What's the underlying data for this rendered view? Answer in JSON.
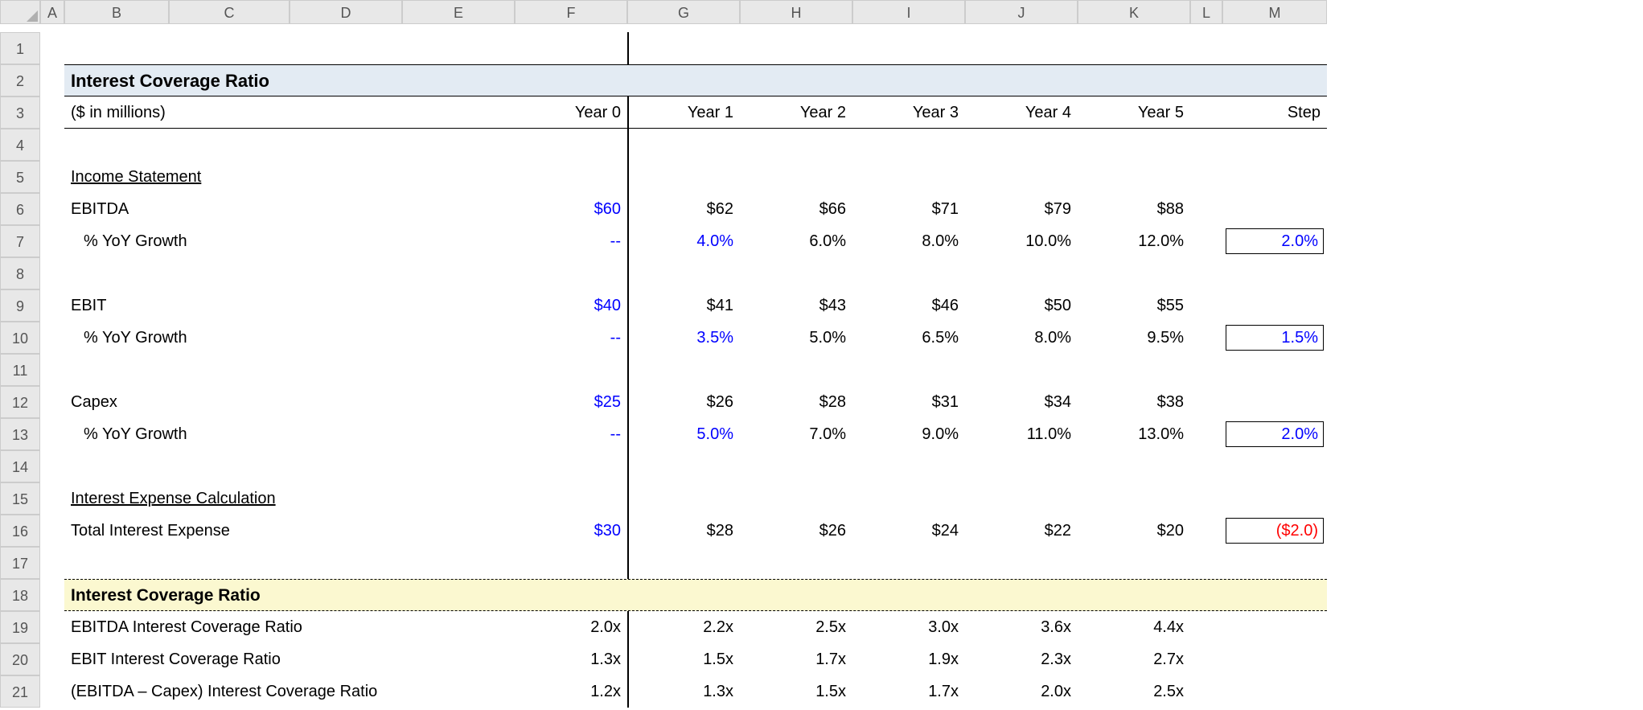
{
  "columns": [
    "A",
    "B",
    "C",
    "D",
    "E",
    "F",
    "G",
    "H",
    "I",
    "J",
    "K",
    "L",
    "M"
  ],
  "rowCount": 21,
  "title": "Interest Coverage Ratio",
  "units": "($ in millions)",
  "yearHeaders": [
    "Year 0",
    "Year 1",
    "Year 2",
    "Year 3",
    "Year 4",
    "Year 5"
  ],
  "stepLabel": "Step",
  "sections": {
    "income": "Income Statement",
    "interestCalc": "Interest Expense Calculation",
    "ratio": "Interest Coverage Ratio"
  },
  "rows": {
    "ebitda": {
      "label": "EBITDA",
      "y0": "$60",
      "y1": "$62",
      "y2": "$66",
      "y3": "$71",
      "y4": "$79",
      "y5": "$88"
    },
    "ebitdaYoY": {
      "label": "% YoY Growth",
      "y0": "--",
      "y1": "4.0%",
      "y2": "6.0%",
      "y3": "8.0%",
      "y4": "10.0%",
      "y5": "12.0%",
      "step": "2.0%"
    },
    "ebit": {
      "label": "EBIT",
      "y0": "$40",
      "y1": "$41",
      "y2": "$43",
      "y3": "$46",
      "y4": "$50",
      "y5": "$55"
    },
    "ebitYoY": {
      "label": "% YoY Growth",
      "y0": "--",
      "y1": "3.5%",
      "y2": "5.0%",
      "y3": "6.5%",
      "y4": "8.0%",
      "y5": "9.5%",
      "step": "1.5%"
    },
    "capex": {
      "label": "Capex",
      "y0": "$25",
      "y1": "$26",
      "y2": "$28",
      "y3": "$31",
      "y4": "$34",
      "y5": "$38"
    },
    "capexYoY": {
      "label": "% YoY Growth",
      "y0": "--",
      "y1": "5.0%",
      "y2": "7.0%",
      "y3": "9.0%",
      "y4": "11.0%",
      "y5": "13.0%",
      "step": "2.0%"
    },
    "intExp": {
      "label": "Total Interest Expense",
      "y0": "$30",
      "y1": "$28",
      "y2": "$26",
      "y3": "$24",
      "y4": "$22",
      "y5": "$20",
      "step": "($2.0)"
    },
    "ratioEbitda": {
      "label": "EBITDA Interest Coverage Ratio",
      "y0": "2.0x",
      "y1": "2.2x",
      "y2": "2.5x",
      "y3": "3.0x",
      "y4": "3.6x",
      "y5": "4.4x"
    },
    "ratioEbit": {
      "label": "EBIT Interest Coverage Ratio",
      "y0": "1.3x",
      "y1": "1.5x",
      "y2": "1.7x",
      "y3": "1.9x",
      "y4": "2.3x",
      "y5": "2.7x"
    },
    "ratioEbCapex": {
      "label": "(EBITDA – Capex) Interest Coverage Ratio",
      "y0": "1.2x",
      "y1": "1.3x",
      "y2": "1.5x",
      "y3": "1.7x",
      "y4": "2.0x",
      "y5": "2.5x"
    }
  },
  "chart_data": {
    "type": "table",
    "title": "Interest Coverage Ratio ($ in millions)",
    "categories": [
      "Year 0",
      "Year 1",
      "Year 2",
      "Year 3",
      "Year 4",
      "Year 5"
    ],
    "series": [
      {
        "name": "EBITDA",
        "values": [
          60,
          62,
          66,
          71,
          79,
          88
        ]
      },
      {
        "name": "EBITDA % YoY Growth",
        "values": [
          null,
          4.0,
          6.0,
          8.0,
          10.0,
          12.0
        ],
        "step": 2.0
      },
      {
        "name": "EBIT",
        "values": [
          40,
          41,
          43,
          46,
          50,
          55
        ]
      },
      {
        "name": "EBIT % YoY Growth",
        "values": [
          null,
          3.5,
          5.0,
          6.5,
          8.0,
          9.5
        ],
        "step": 1.5
      },
      {
        "name": "Capex",
        "values": [
          25,
          26,
          28,
          31,
          34,
          38
        ]
      },
      {
        "name": "Capex % YoY Growth",
        "values": [
          null,
          5.0,
          7.0,
          9.0,
          11.0,
          13.0
        ],
        "step": 2.0
      },
      {
        "name": "Total Interest Expense",
        "values": [
          30,
          28,
          26,
          24,
          22,
          20
        ],
        "step": -2.0
      },
      {
        "name": "EBITDA Interest Coverage Ratio",
        "values": [
          2.0,
          2.2,
          2.5,
          3.0,
          3.6,
          4.4
        ]
      },
      {
        "name": "EBIT Interest Coverage Ratio",
        "values": [
          1.3,
          1.5,
          1.7,
          1.9,
          2.3,
          2.7
        ]
      },
      {
        "name": "(EBITDA – Capex) Interest Coverage Ratio",
        "values": [
          1.2,
          1.3,
          1.5,
          1.7,
          2.0,
          2.5
        ]
      }
    ]
  }
}
